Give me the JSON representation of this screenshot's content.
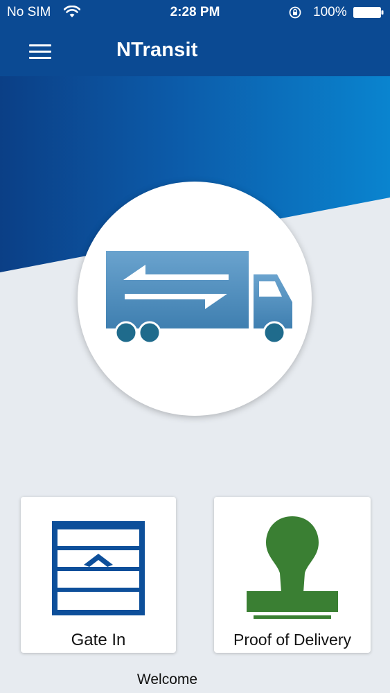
{
  "status_bar": {
    "carrier": "No SIM",
    "time": "2:28 PM",
    "battery": "100%"
  },
  "nav": {
    "title": "NTransit"
  },
  "icons": {
    "menu": "hamburger-menu-icon",
    "hero": "truck-icon",
    "gate_in": "garage-door-icon",
    "proof_of_delivery": "rubber-stamp-icon"
  },
  "tiles": [
    {
      "label": "Gate In"
    },
    {
      "label": "Proof of Delivery"
    }
  ],
  "footer": {
    "welcome": "Welcome"
  },
  "colors": {
    "brand_blue": "#0b4a93",
    "accent_blue": "#0a7cc8",
    "truck_blue": "#4b8bbb",
    "truck_wheel": "#1f6b8c",
    "gate_blue": "#0d4f9a",
    "stamp_green": "#3a7f33",
    "background": "#e7ebf0"
  }
}
